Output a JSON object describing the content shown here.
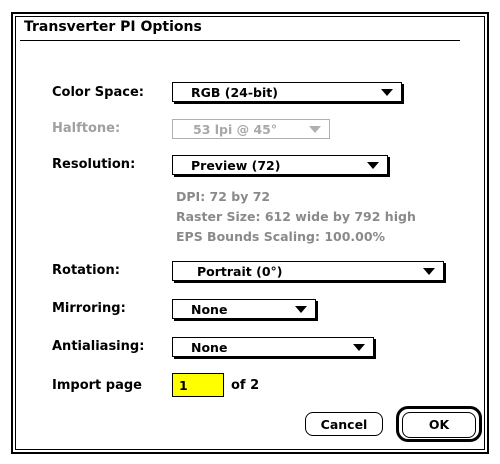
{
  "dialog": {
    "title": "Transverter PI Options",
    "color_space": {
      "label": "Color Space:",
      "value": "RGB (24-bit)"
    },
    "halftone": {
      "label": "Halftone:",
      "value": "53 lpi @ 45°"
    },
    "resolution": {
      "label": "Resolution:",
      "value": "Preview (72)",
      "info_dpi": "DPI: 72 by 72",
      "info_raster": "Raster Size: 612 wide by 792 high",
      "info_eps": "EPS Bounds Scaling: 100.00%"
    },
    "rotation": {
      "label": "Rotation:",
      "value": "Portrait (0°)"
    },
    "mirroring": {
      "label": "Mirroring:",
      "value": "None"
    },
    "antialiasing": {
      "label": "Antialiasing:",
      "value": "None"
    },
    "import_page": {
      "label": "Import page",
      "value": "1",
      "of_text": "of 2",
      "highlight_color": "#ffff00"
    },
    "buttons": {
      "cancel": "Cancel",
      "ok": "OK"
    }
  }
}
